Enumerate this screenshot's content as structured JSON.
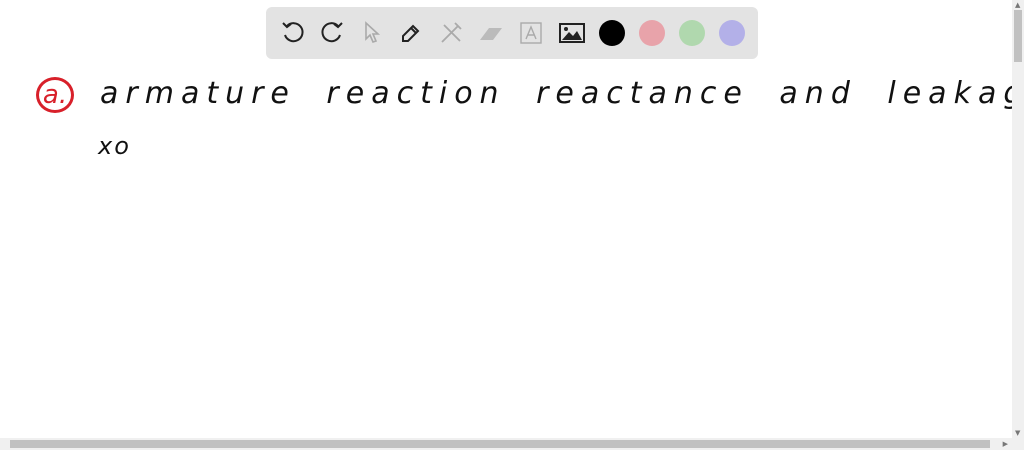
{
  "toolbar": {
    "tools": [
      "undo-icon",
      "redo-icon",
      "select-icon",
      "pen-icon",
      "tools-icon",
      "eraser-icon",
      "text-icon",
      "image-icon"
    ],
    "colors": {
      "black": "#000000",
      "red": "#e8a3aa",
      "green": "#b0d8ae",
      "blue": "#b3b0e8"
    }
  },
  "canvas": {
    "marker": "a.",
    "line1": "armature reaction reactance and leakage",
    "line2": "xo"
  }
}
